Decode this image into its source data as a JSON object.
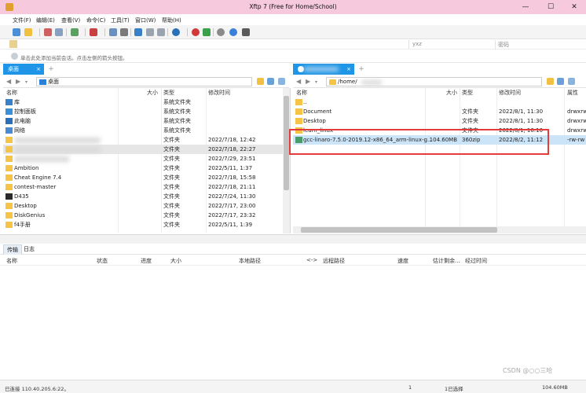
{
  "window": {
    "title": "Xftp 7 (Free for Home/School)",
    "controls": [
      "—",
      "☐",
      "✕"
    ]
  },
  "menu": [
    "文件(F)",
    "编辑(E)",
    "查看(V)",
    "命令(C)",
    "工具(T)",
    "窗口(W)",
    "帮助(H)"
  ],
  "address": {
    "user_placeholder": "yxz",
    "password_placeholder": "密码"
  },
  "info": {
    "text": "单击此处添加当前会话。点击左侧的箭头按钮。"
  },
  "tabs": {
    "left": {
      "label": "桌面",
      "close": "×"
    },
    "right": {
      "label": "",
      "close": "×"
    },
    "add": "+"
  },
  "left_panel": {
    "path": "桌面",
    "columns": [
      "名称",
      "大小",
      "类型",
      "修改时间"
    ],
    "rows": [
      {
        "name": "库",
        "size": "",
        "type": "系统文件夹",
        "date": "",
        "icon": "library-icon"
      },
      {
        "name": "控制面板",
        "size": "",
        "type": "系统文件夹",
        "date": "",
        "icon": "control-panel-icon"
      },
      {
        "name": "此电脑",
        "size": "",
        "type": "系统文件夹",
        "date": "",
        "icon": "computer-icon"
      },
      {
        "name": "网络",
        "size": "",
        "type": "系统文件夹",
        "date": "",
        "icon": "network-icon"
      },
      {
        "name": "",
        "size": "",
        "type": "文件夹",
        "date": "2022/7/18, 12:42",
        "icon": "folder-icon"
      },
      {
        "name": "",
        "size": "",
        "type": "文件夹",
        "date": "2022/7/18, 22:27",
        "icon": "folder-icon"
      },
      {
        "name": "",
        "size": "",
        "type": "文件夹",
        "date": "2022/7/29, 23:51",
        "icon": "folder-icon"
      },
      {
        "name": "Ambition",
        "size": "",
        "type": "文件夹",
        "date": "2022/5/11, 1:37",
        "icon": "folder-icon"
      },
      {
        "name": "Cheat Engine 7.4",
        "size": "",
        "type": "文件夹",
        "date": "2022/7/18, 15:58",
        "icon": "folder-icon"
      },
      {
        "name": "contest-master",
        "size": "",
        "type": "文件夹",
        "date": "2022/7/18, 21:11",
        "icon": "folder-icon"
      },
      {
        "name": "D435",
        "size": "",
        "type": "文件夹",
        "date": "2022/7/24, 11:30",
        "icon": "folder-dark-icon"
      },
      {
        "name": "Desktop",
        "size": "",
        "type": "文件夹",
        "date": "2022/7/17, 23:00",
        "icon": "folder-icon"
      },
      {
        "name": "DiskGenius",
        "size": "",
        "type": "文件夹",
        "date": "2022/7/17, 23:32",
        "icon": "folder-icon"
      },
      {
        "name": "f4手册",
        "size": "",
        "type": "文件夹",
        "date": "2022/5/11, 1:39",
        "icon": "folder-icon"
      }
    ]
  },
  "right_panel": {
    "path": "/home/",
    "columns": [
      "名称",
      "大小",
      "类型",
      "修改时间",
      "属性"
    ],
    "rows": [
      {
        "name": "..",
        "size": "",
        "type": "",
        "date": "",
        "perm": "",
        "icon": "folder-icon"
      },
      {
        "name": "Document",
        "size": "",
        "type": "文件夹",
        "date": "2022/8/1, 11:30",
        "perm": "drwxrw",
        "icon": "folder-icon"
      },
      {
        "name": "Desktop",
        "size": "",
        "type": "文件夹",
        "date": "2022/8/1, 11:30",
        "perm": "drwxrw",
        "icon": "folder-icon"
      },
      {
        "name": "learn_linux",
        "size": "",
        "type": "文件夹",
        "date": "2022/8/1, 16:10",
        "perm": "drwxrw",
        "icon": "folder-icon"
      },
      {
        "name": "gcc-linaro-7.5.0-2019.12-x86_64_arm-linux-g...",
        "size": "104.60MB",
        "type": "360zip",
        "date": "2022/8/2, 11:12",
        "perm": "-rw-rw",
        "icon": "archive-icon"
      }
    ]
  },
  "transfer": {
    "tabs": [
      "传输",
      "日志"
    ],
    "columns": [
      "名称",
      "状态",
      "进度",
      "大小",
      "本地路径",
      "<->",
      "远程路径",
      "速度",
      "估计剩余...",
      "经过时间"
    ]
  },
  "status": {
    "connected": "已连接 110.40.205.6:22。",
    "objects": "1",
    "selected": "1已选择",
    "size": "104.60MB"
  },
  "watermark": "CSDN @○○三哈",
  "colors": {
    "tab_active": "#1e95e6",
    "titlebar": "#f6c9dd",
    "selected_row": "#cce4f7",
    "highlight_box": "#e23c3c"
  }
}
